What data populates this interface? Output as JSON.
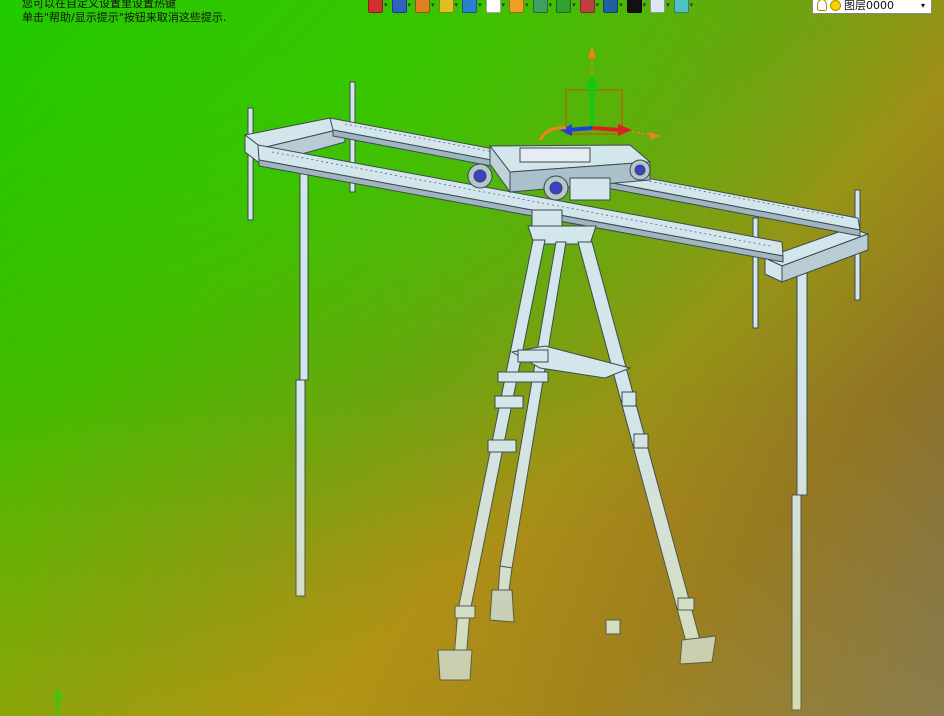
{
  "hints": {
    "line1": "您可以在自定义设置里设置热键",
    "line2": "单击\"帮助/显示提示\"按钮来取消这些提示."
  },
  "toolbar": {
    "icons": [
      {
        "name": "exit-sketch-icon",
        "color": "#d03030"
      },
      {
        "name": "view-orient-icon",
        "color": "#3060c0"
      },
      {
        "name": "pencil-icon",
        "color": "#e08020"
      },
      {
        "name": "section-view-icon",
        "color": "#e0c020"
      },
      {
        "name": "display-style-icon",
        "color": "#2a80d0"
      },
      {
        "name": "hide-show-icon",
        "color": "#ffffff"
      },
      {
        "name": "appearance-icon",
        "color": "#f0a020"
      },
      {
        "name": "zoom-icon",
        "color": "#40a060"
      },
      {
        "name": "rotate-icon",
        "color": "#30a030"
      },
      {
        "name": "calendar-icon",
        "color": "#c04040"
      },
      {
        "name": "monitor-icon",
        "color": "#2060a0"
      },
      {
        "name": "line-color-icon",
        "color": "#111111"
      },
      {
        "name": "fill-color-icon",
        "color": "#dde8f4"
      },
      {
        "name": "layer-tool-icon",
        "color": "#50c0c0"
      }
    ],
    "dropdown_glyph": "▾"
  },
  "layer": {
    "value": "图层0000",
    "dropdown_glyph": "▾"
  },
  "colors": {
    "model_light": "#d3e6ec",
    "model_stroke": "#3c4a52",
    "axis_y": "#14c814",
    "axis_x": "#e02020",
    "axis_z": "#2040d8",
    "axis_ring": "#f08020"
  }
}
